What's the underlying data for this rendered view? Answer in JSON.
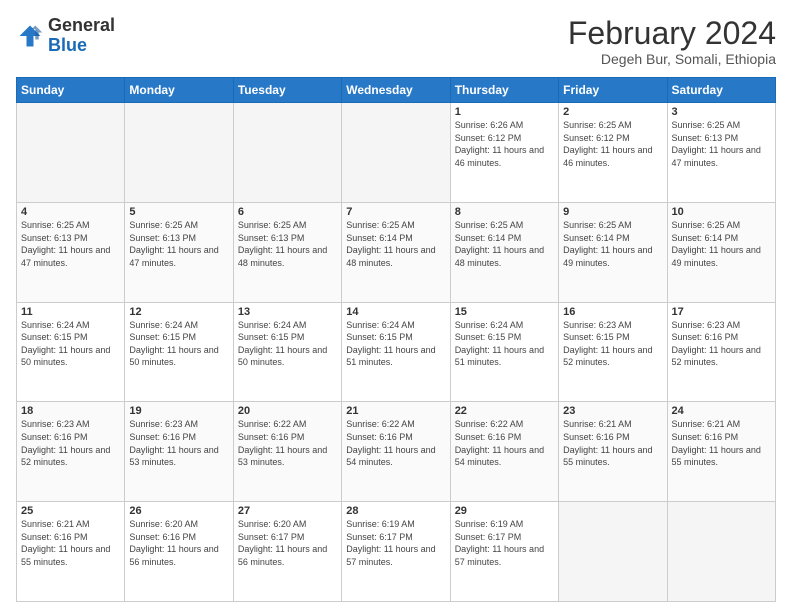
{
  "header": {
    "logo_general": "General",
    "logo_blue": "Blue",
    "month_year": "February 2024",
    "location": "Degeh Bur, Somali, Ethiopia"
  },
  "days_of_week": [
    "Sunday",
    "Monday",
    "Tuesday",
    "Wednesday",
    "Thursday",
    "Friday",
    "Saturday"
  ],
  "weeks": [
    [
      {
        "day": "",
        "sunrise": "",
        "sunset": "",
        "daylight": ""
      },
      {
        "day": "",
        "sunrise": "",
        "sunset": "",
        "daylight": ""
      },
      {
        "day": "",
        "sunrise": "",
        "sunset": "",
        "daylight": ""
      },
      {
        "day": "",
        "sunrise": "",
        "sunset": "",
        "daylight": ""
      },
      {
        "day": "1",
        "sunrise": "6:26 AM",
        "sunset": "6:12 PM",
        "daylight": "11 hours and 46 minutes."
      },
      {
        "day": "2",
        "sunrise": "6:25 AM",
        "sunset": "6:12 PM",
        "daylight": "11 hours and 46 minutes."
      },
      {
        "day": "3",
        "sunrise": "6:25 AM",
        "sunset": "6:13 PM",
        "daylight": "11 hours and 47 minutes."
      }
    ],
    [
      {
        "day": "4",
        "sunrise": "6:25 AM",
        "sunset": "6:13 PM",
        "daylight": "11 hours and 47 minutes."
      },
      {
        "day": "5",
        "sunrise": "6:25 AM",
        "sunset": "6:13 PM",
        "daylight": "11 hours and 47 minutes."
      },
      {
        "day": "6",
        "sunrise": "6:25 AM",
        "sunset": "6:13 PM",
        "daylight": "11 hours and 48 minutes."
      },
      {
        "day": "7",
        "sunrise": "6:25 AM",
        "sunset": "6:14 PM",
        "daylight": "11 hours and 48 minutes."
      },
      {
        "day": "8",
        "sunrise": "6:25 AM",
        "sunset": "6:14 PM",
        "daylight": "11 hours and 48 minutes."
      },
      {
        "day": "9",
        "sunrise": "6:25 AM",
        "sunset": "6:14 PM",
        "daylight": "11 hours and 49 minutes."
      },
      {
        "day": "10",
        "sunrise": "6:25 AM",
        "sunset": "6:14 PM",
        "daylight": "11 hours and 49 minutes."
      }
    ],
    [
      {
        "day": "11",
        "sunrise": "6:24 AM",
        "sunset": "6:15 PM",
        "daylight": "11 hours and 50 minutes."
      },
      {
        "day": "12",
        "sunrise": "6:24 AM",
        "sunset": "6:15 PM",
        "daylight": "11 hours and 50 minutes."
      },
      {
        "day": "13",
        "sunrise": "6:24 AM",
        "sunset": "6:15 PM",
        "daylight": "11 hours and 50 minutes."
      },
      {
        "day": "14",
        "sunrise": "6:24 AM",
        "sunset": "6:15 PM",
        "daylight": "11 hours and 51 minutes."
      },
      {
        "day": "15",
        "sunrise": "6:24 AM",
        "sunset": "6:15 PM",
        "daylight": "11 hours and 51 minutes."
      },
      {
        "day": "16",
        "sunrise": "6:23 AM",
        "sunset": "6:15 PM",
        "daylight": "11 hours and 52 minutes."
      },
      {
        "day": "17",
        "sunrise": "6:23 AM",
        "sunset": "6:16 PM",
        "daylight": "11 hours and 52 minutes."
      }
    ],
    [
      {
        "day": "18",
        "sunrise": "6:23 AM",
        "sunset": "6:16 PM",
        "daylight": "11 hours and 52 minutes."
      },
      {
        "day": "19",
        "sunrise": "6:23 AM",
        "sunset": "6:16 PM",
        "daylight": "11 hours and 53 minutes."
      },
      {
        "day": "20",
        "sunrise": "6:22 AM",
        "sunset": "6:16 PM",
        "daylight": "11 hours and 53 minutes."
      },
      {
        "day": "21",
        "sunrise": "6:22 AM",
        "sunset": "6:16 PM",
        "daylight": "11 hours and 54 minutes."
      },
      {
        "day": "22",
        "sunrise": "6:22 AM",
        "sunset": "6:16 PM",
        "daylight": "11 hours and 54 minutes."
      },
      {
        "day": "23",
        "sunrise": "6:21 AM",
        "sunset": "6:16 PM",
        "daylight": "11 hours and 55 minutes."
      },
      {
        "day": "24",
        "sunrise": "6:21 AM",
        "sunset": "6:16 PM",
        "daylight": "11 hours and 55 minutes."
      }
    ],
    [
      {
        "day": "25",
        "sunrise": "6:21 AM",
        "sunset": "6:16 PM",
        "daylight": "11 hours and 55 minutes."
      },
      {
        "day": "26",
        "sunrise": "6:20 AM",
        "sunset": "6:16 PM",
        "daylight": "11 hours and 56 minutes."
      },
      {
        "day": "27",
        "sunrise": "6:20 AM",
        "sunset": "6:17 PM",
        "daylight": "11 hours and 56 minutes."
      },
      {
        "day": "28",
        "sunrise": "6:19 AM",
        "sunset": "6:17 PM",
        "daylight": "11 hours and 57 minutes."
      },
      {
        "day": "29",
        "sunrise": "6:19 AM",
        "sunset": "6:17 PM",
        "daylight": "11 hours and 57 minutes."
      },
      {
        "day": "",
        "sunrise": "",
        "sunset": "",
        "daylight": ""
      },
      {
        "day": "",
        "sunrise": "",
        "sunset": "",
        "daylight": ""
      }
    ]
  ]
}
